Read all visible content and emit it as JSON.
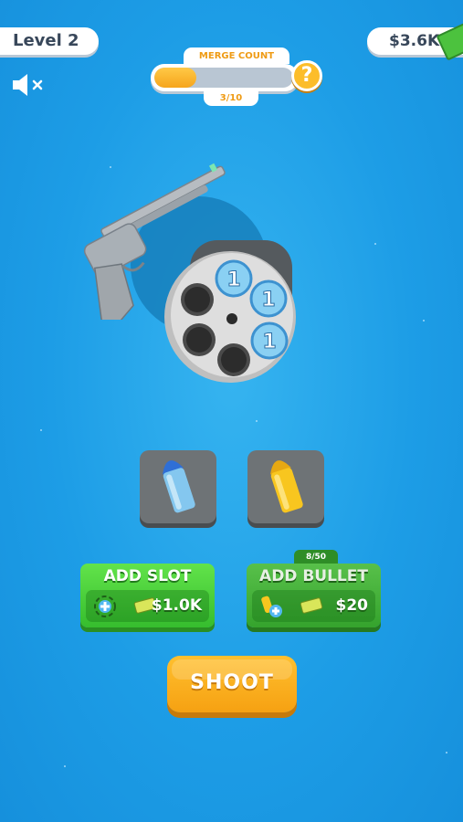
{
  "hud": {
    "level_label": "Level 2",
    "money": "$3.6K"
  },
  "merge": {
    "title": "MERGE COUNT",
    "count": "3/10",
    "progress": 0.3,
    "help_symbol": "?"
  },
  "cylinder": {
    "chambers": [
      {
        "slot": "top-right",
        "value": "1"
      },
      {
        "slot": "right",
        "value": "1"
      },
      {
        "slot": "bottom-right",
        "value": "1"
      },
      {
        "slot": "bottom",
        "value": ""
      },
      {
        "slot": "bottom-left",
        "value": ""
      },
      {
        "slot": "top-left",
        "value": ""
      }
    ]
  },
  "inventory": {
    "slots": [
      {
        "item": "blue-bullet-icon",
        "color": "#7fc3ec"
      },
      {
        "item": "gold-bullet-icon",
        "color": "#f7c21c"
      }
    ]
  },
  "actions": {
    "add_slot": {
      "label": "ADD SLOT",
      "price": "$1.0K",
      "icon": "target-plus-icon"
    },
    "add_bullet": {
      "label": "ADD BULLET",
      "price": "$20",
      "icon": "bullet-plus-icon",
      "counter": "8/50"
    },
    "shoot_label": "SHOOT"
  },
  "icons": {
    "mute": "speaker-muted-icon",
    "cash": "cash-icon"
  },
  "colors": {
    "background": "#1d9de6",
    "accent_orange": "#f6a51c",
    "button_green": "#36bd2e"
  }
}
